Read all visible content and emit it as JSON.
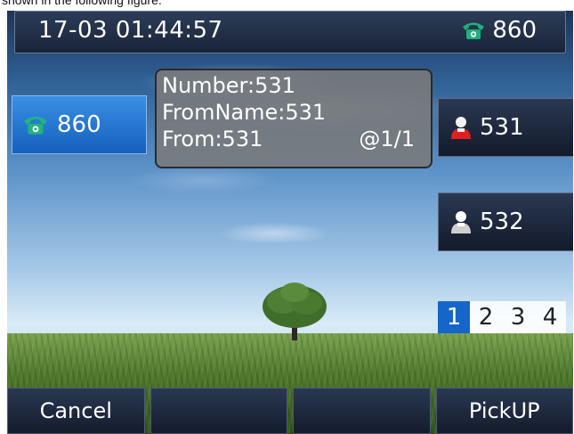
{
  "caption": "shown in the following figure.",
  "status_bar": {
    "datetime": "17-03 01:44:57",
    "account": "860",
    "account_icon": "phone-icon"
  },
  "line_keys": {
    "left": {
      "label": "860",
      "icon": "phone-icon",
      "color": "#1a6fd0"
    },
    "right": [
      {
        "label": "531",
        "icon": "contact-ringing-icon",
        "icon_color": "#e02020"
      },
      {
        "label": "532",
        "icon": "contact-idle-icon",
        "icon_color": "#cfcfcf"
      }
    ]
  },
  "popup": {
    "number": "Number:531",
    "from_name": "FromName:531",
    "from": "From:531",
    "pager": "@1/1"
  },
  "pages": {
    "items": [
      "1",
      "2",
      "3",
      "4"
    ],
    "active": "1",
    "active_color": "#1566c8"
  },
  "softkeys": [
    "Cancel",
    "",
    "",
    "PickUP"
  ]
}
